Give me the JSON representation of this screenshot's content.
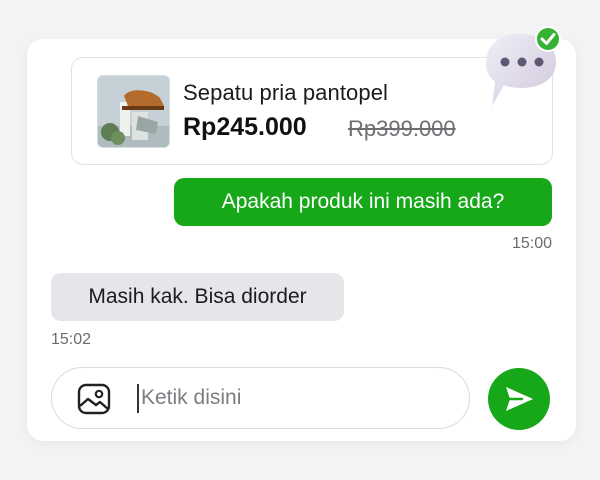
{
  "product": {
    "title": "Sepatu pria pantopel",
    "price": "Rp245.000",
    "original_price": "Rp399.000"
  },
  "messages": [
    {
      "direction": "outgoing",
      "text": "Apakah produk ini masih ada?",
      "time": "15:00"
    },
    {
      "direction": "incoming",
      "text": "Masih kak. Bisa diorder",
      "time": "15:02"
    }
  ],
  "composer": {
    "placeholder": "Ketik disini",
    "value": ""
  },
  "icons": {
    "attach": "image-icon",
    "send": "send-icon",
    "badge": "chat-bubble-icon",
    "badge_check": "check-icon"
  },
  "colors": {
    "accent": "#16a819",
    "incoming_bubble": "#e5e6ea",
    "background": "#f3f3f5"
  }
}
